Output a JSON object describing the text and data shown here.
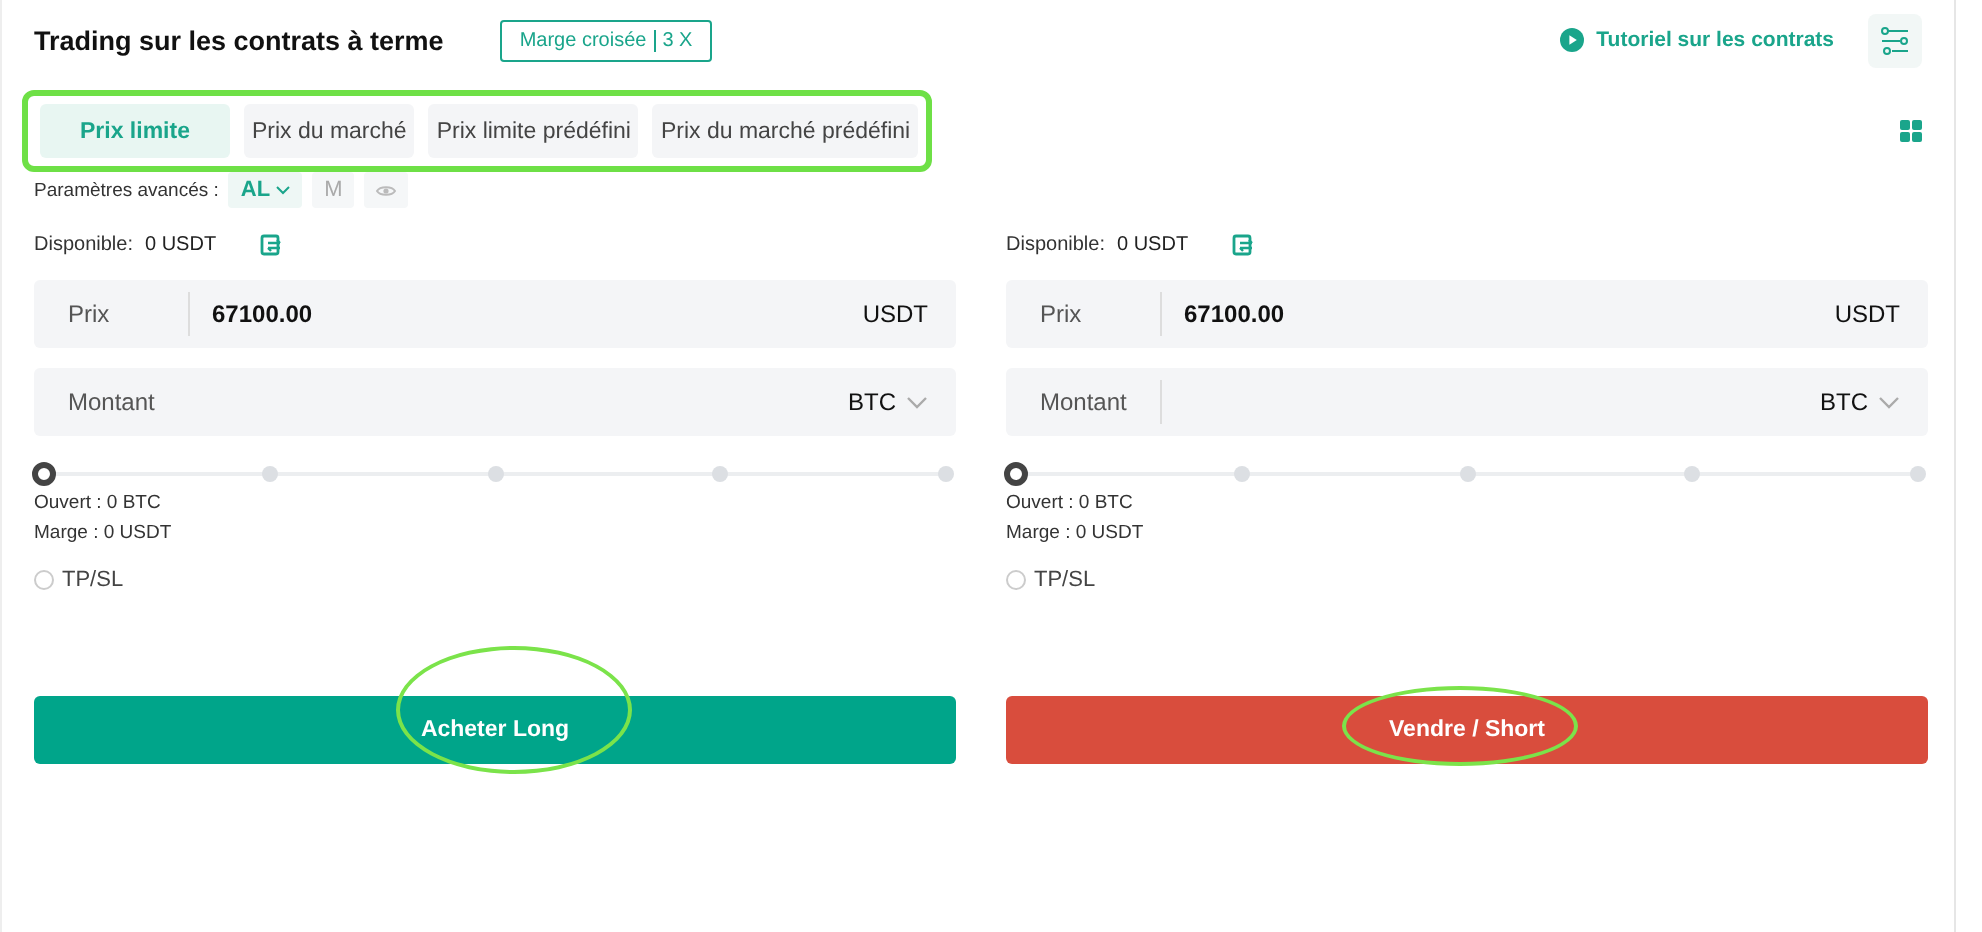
{
  "header": {
    "title": "Trading sur les contrats à terme",
    "margin_mode": "Marge croisée",
    "leverage": "3 X",
    "tutorial_link": "Tutoriel sur les contrats"
  },
  "order_types": {
    "highlighted": true,
    "tabs": [
      {
        "label": "Prix limite",
        "selected": true
      },
      {
        "label": "Prix du marché",
        "selected": false
      },
      {
        "label": "Prix limite prédéfini",
        "selected": false
      },
      {
        "label": "Prix du marché prédéfini",
        "selected": false
      }
    ]
  },
  "advanced": {
    "label": "Paramètres avancés :",
    "options": [
      {
        "label": "AL",
        "selected": true,
        "kind": "dropdown"
      },
      {
        "label": "M",
        "selected": false,
        "kind": "text"
      },
      {
        "selected": false,
        "kind": "eye"
      }
    ]
  },
  "sides": [
    {
      "kind": "buy",
      "available_label": "Disponible:",
      "available": "0 USDT",
      "price_label": "Prix",
      "price": "67100.00",
      "price_unit": "USDT",
      "amount_label": "Montant",
      "amount_unit": "BTC",
      "slider": {
        "level": 0
      },
      "open": "Ouvert : 0 BTC",
      "margin": "Marge : 0 USDT",
      "tpsl": {
        "label": "TP/SL",
        "checked": false
      },
      "button": {
        "label": "Acheter Long",
        "highlighted": true
      }
    },
    {
      "kind": "sell",
      "available_label": "Disponible:",
      "available": "0 USDT",
      "price_label": "Prix",
      "price": "67100.00",
      "price_unit": "USDT",
      "amount_label": "Montant",
      "amount_unit": "BTC",
      "slider": {
        "level": 0
      },
      "open": "Ouvert : 0 BTC",
      "margin": "Marge : 0 USDT",
      "tpsl": {
        "label": "TP/SL",
        "checked": false
      },
      "button": {
        "label": "Vendre / Short",
        "highlighted": true
      }
    }
  ]
}
